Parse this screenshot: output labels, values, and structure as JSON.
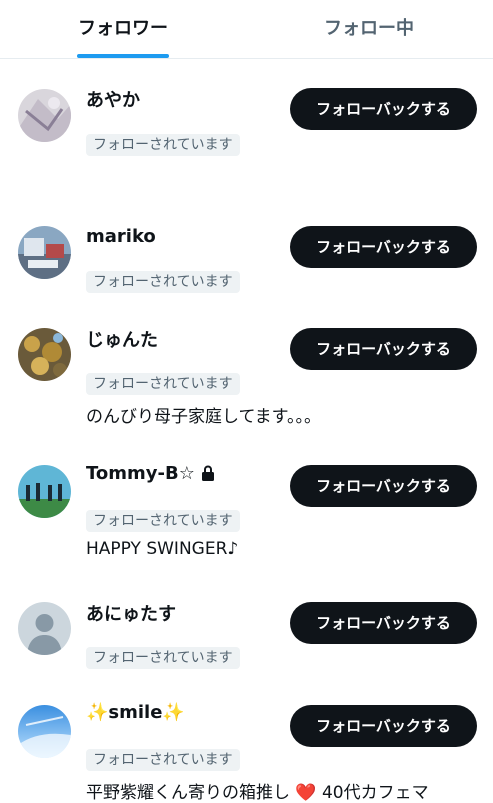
{
  "tabs": {
    "followers": "フォロワー",
    "following": "フォロー中"
  },
  "followback_label": "フォローバックする",
  "followed_label": "フォローされています",
  "users": [
    {
      "name": "あやか",
      "bio": ""
    },
    {
      "name": "mariko",
      "bio": ""
    },
    {
      "name": "じゅんた",
      "bio": "のんびり母子家庭してます。。。"
    },
    {
      "name": "Tommy-B☆",
      "bio": "HAPPY SWINGER♪",
      "locked": true
    },
    {
      "name": "あにゅたす",
      "bio": ""
    },
    {
      "name": "✨smile✨",
      "bio": "平野紫耀くん寄りの箱推し ❤️ 40代カフェマ"
    }
  ]
}
